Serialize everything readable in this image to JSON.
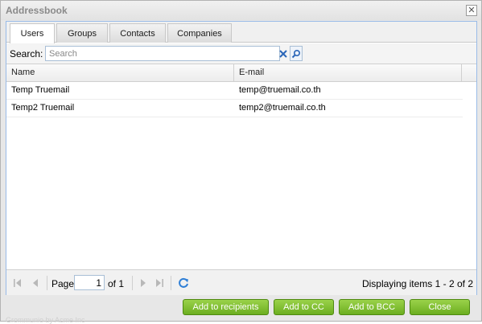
{
  "window": {
    "title": "Addressbook",
    "close_glyph": "✕"
  },
  "tabs": [
    {
      "label": "Users",
      "active": true
    },
    {
      "label": "Groups",
      "active": false
    },
    {
      "label": "Contacts",
      "active": false
    },
    {
      "label": "Companies",
      "active": false
    }
  ],
  "search": {
    "label": "Search:",
    "placeholder": "Search",
    "value": ""
  },
  "grid": {
    "columns": [
      "Name",
      "E-mail"
    ],
    "rows": [
      {
        "name": "Temp Truemail",
        "email": "temp@truemail.co.th"
      },
      {
        "name": "Temp2 Truemail",
        "email": "temp2@truemail.co.th"
      }
    ]
  },
  "pager": {
    "page_label": "Page",
    "page_value": "1",
    "of_label": "of 1",
    "display_info": "Displaying items 1 - 2 of 2"
  },
  "buttons": {
    "add_recipients": "Add to recipients",
    "add_cc": "Add to CC",
    "add_bcc": "Add to BCC",
    "close": "Close"
  },
  "footer_text": "Grommunio by Acme Inc",
  "colors": {
    "accent_button": "#7fbf2f",
    "tab_border": "#99bbe8",
    "search_icon": "#2b66b8",
    "clear_icon": "#2b66b8"
  },
  "icons": [
    "close-icon",
    "clear-search-icon",
    "search-icon",
    "first-page-icon",
    "prev-page-icon",
    "next-page-icon",
    "last-page-icon",
    "refresh-icon"
  ]
}
